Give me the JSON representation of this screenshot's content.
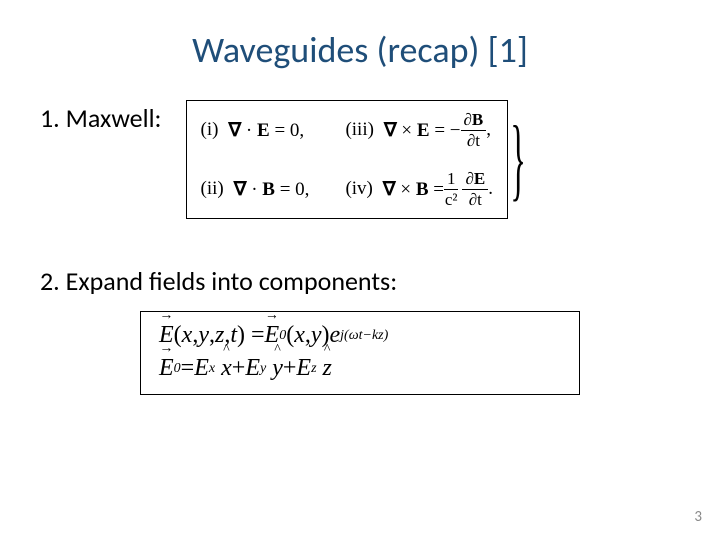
{
  "slide": {
    "title": "Waveguides (recap) [1]",
    "page_number": "3"
  },
  "item1": {
    "label": "1.  Maxwell:",
    "eqs": {
      "i_rn": "(i)",
      "i_body": "∇ · E = 0,",
      "ii_rn": "(ii)",
      "ii_body": "∇ · B = 0,",
      "iii_rn": "(iii)",
      "iii_lead": "∇ × E = −",
      "iii_num": "∂B",
      "iii_den": "∂t",
      "iii_tail": ",",
      "iv_rn": "(iv)",
      "iv_lead": "∇ × B = ",
      "iv_frac1_num": "1",
      "iv_frac1_den": "c²",
      "iv_frac2_num": "∂E",
      "iv_frac2_den": "∂t",
      "iv_tail": "."
    }
  },
  "item2": {
    "label": "2.  Expand fields into components:",
    "line1": {
      "Evec": "E",
      "args": "(x, y, z, t) = ",
      "E0vec": "E",
      "E0sub": "0",
      "args2": "(x, y) e",
      "exp": "j(ωt−kz)"
    },
    "line2": {
      "E0vec": "E",
      "E0sub": "0",
      "eq": " = ",
      "Ex": "E",
      "xs": "x",
      "xh": "x",
      "Ey": "E",
      "ys": "y",
      "yh": "y",
      "Ez": "E",
      "zs": "z",
      "zh": "z",
      "plus": " + "
    }
  }
}
